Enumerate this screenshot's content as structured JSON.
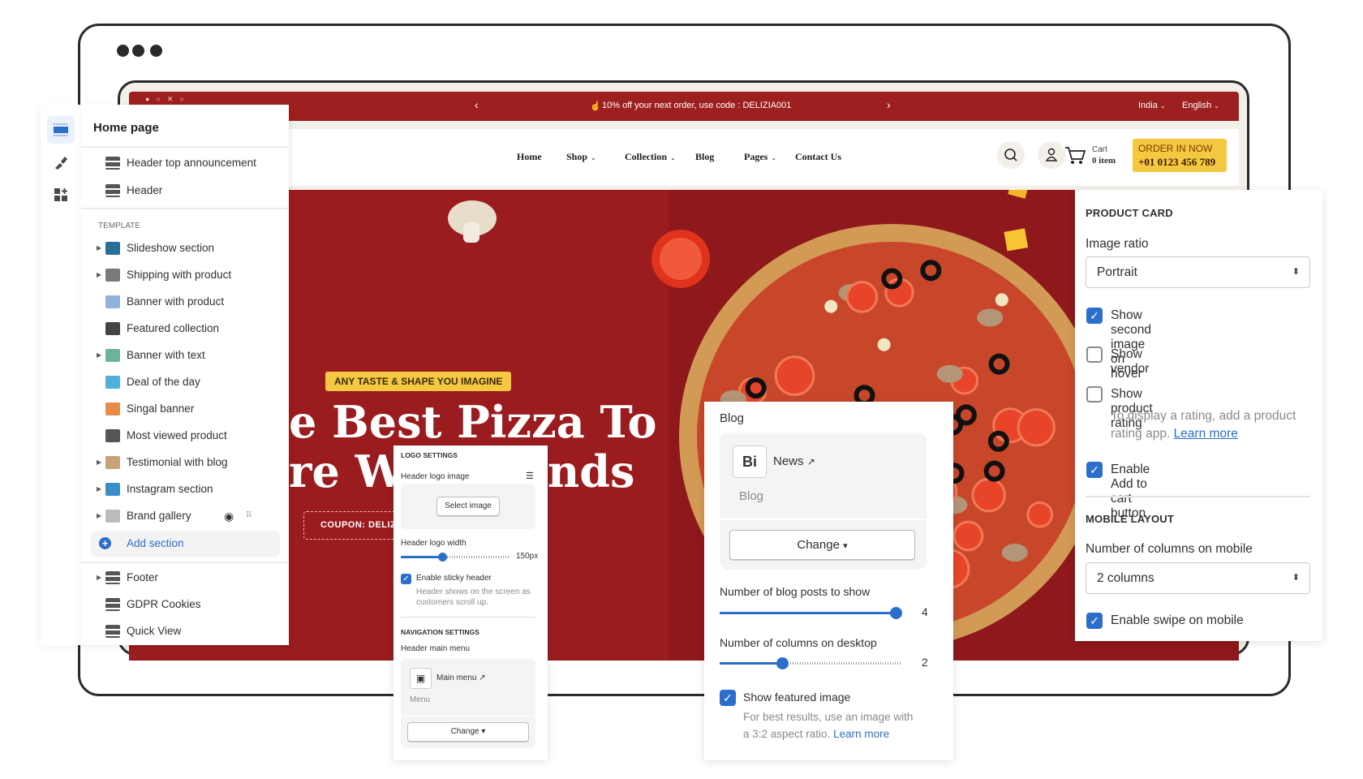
{
  "colors": {
    "brand_red": "#9e1f20",
    "accent_yellow": "#f5c842",
    "primary_blue": "#2c6ecb"
  },
  "announcement": {
    "prev_icon": "chevron-left-icon",
    "text": "10% off your next order, use code : DELIZIA001",
    "next_icon": "chevron-right-icon",
    "country": "India",
    "language": "English"
  },
  "header": {
    "nav": [
      {
        "label": "Home",
        "dropdown": false
      },
      {
        "label": "Shop",
        "dropdown": true
      },
      {
        "label": "Collection",
        "dropdown": true
      },
      {
        "label": "Blog",
        "dropdown": false
      },
      {
        "label": "Pages",
        "dropdown": true
      },
      {
        "label": "Contact Us",
        "dropdown": false
      }
    ],
    "cart_label": "Cart",
    "cart_count": "0 item",
    "order_label": "ORDER IN NOW",
    "order_phone": "+01 0123 456 789"
  },
  "hero": {
    "badge": "ANY TASTE & SHAPE YOU IMAGINE",
    "line1": "e Best Pizza To",
    "line2a": "re Wi",
    "line2b": "nds",
    "coupon": "COUPON: DELIZIA"
  },
  "sidebar": {
    "title": "Home page",
    "top_items": [
      {
        "label": "Header top announcement"
      },
      {
        "label": "Header"
      }
    ],
    "template_label": "TEMPLATE",
    "template_items": [
      {
        "label": "Slideshow section",
        "expandable": true
      },
      {
        "label": "Shipping with product",
        "expandable": true
      },
      {
        "label": "Banner with product",
        "expandable": false
      },
      {
        "label": "Featured collection",
        "expandable": false
      },
      {
        "label": "Banner with text",
        "expandable": true
      },
      {
        "label": "Deal of the day",
        "expandable": false
      },
      {
        "label": "Singal banner",
        "expandable": false
      },
      {
        "label": "Most viewed product",
        "expandable": false
      },
      {
        "label": "Testimonial with blog",
        "expandable": true
      },
      {
        "label": "Instagram section",
        "expandable": true
      },
      {
        "label": "Brand gallery",
        "expandable": true
      }
    ],
    "add_section": "Add section",
    "bottom_items": [
      {
        "label": "Footer",
        "expandable": true
      },
      {
        "label": "GDPR Cookies"
      },
      {
        "label": "Quick View"
      }
    ]
  },
  "logo_panel": {
    "section1": "LOGO SETTINGS",
    "logo_image_label": "Header logo image",
    "select_image": "Select image",
    "logo_width_label": "Header logo width",
    "logo_width_value": "150px",
    "logo_width_fraction": 0.38,
    "sticky_label": "Enable sticky header",
    "sticky_checked": true,
    "sticky_help1": "Header shows on the screen as",
    "sticky_help2": "customers scroll up.",
    "section2": "NAVIGATION SETTINGS",
    "menu_label": "Header main menu",
    "menu_name": "Main menu",
    "menu_type": "Menu",
    "change": "Change"
  },
  "blog_panel": {
    "label": "Blog",
    "blog_name": "News",
    "blog_type": "Blog",
    "change": "Change",
    "posts_label": "Number of blog posts to show",
    "posts_value": "4",
    "columns_label": "Number of columns on desktop",
    "columns_value": "2",
    "featured_label": "Show featured image",
    "featured_checked": true,
    "help1": "For best results, use an image with",
    "help2": "a 3:2 aspect ratio.",
    "help_link": "Learn more"
  },
  "product_panel": {
    "heading": "PRODUCT CARD",
    "ratio_label": "Image ratio",
    "ratio_value": "Portrait",
    "options": [
      {
        "label": "Show second image on hover",
        "checked": true
      },
      {
        "label": "Show vendor",
        "checked": false
      },
      {
        "label": "Show product rating",
        "checked": false
      },
      {
        "label": "Enable Add to cart button",
        "checked": true
      }
    ],
    "rating_help1": "To display a rating, add a product",
    "rating_help2": "rating app.",
    "rating_link": "Learn more",
    "mobile_heading": "MOBILE LAYOUT",
    "mobile_cols_label": "Number of columns on mobile",
    "mobile_cols_value": "2 columns",
    "swipe_label": "Enable swipe on mobile",
    "swipe_checked": true
  }
}
